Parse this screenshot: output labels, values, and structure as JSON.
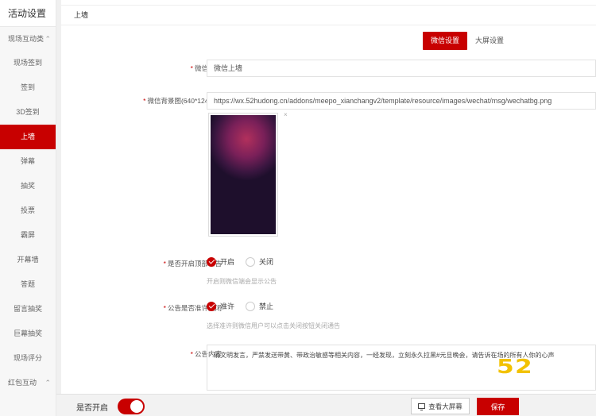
{
  "sidebar": {
    "title": "活动设置",
    "group1": {
      "label": "现场互动类",
      "chevron": "⌃"
    },
    "items": [
      {
        "label": "现场签到",
        "active": false
      },
      {
        "label": "签到",
        "active": false
      },
      {
        "label": "3D签到",
        "active": false
      },
      {
        "label": "上墙",
        "active": true
      },
      {
        "label": "弹幕",
        "active": false
      },
      {
        "label": "抽奖",
        "active": false
      },
      {
        "label": "投票",
        "active": false
      },
      {
        "label": "霸屏",
        "active": false
      },
      {
        "label": "开幕墙",
        "active": false
      },
      {
        "label": "答题",
        "active": false
      },
      {
        "label": "留言抽奖",
        "active": false
      },
      {
        "label": "巨幕抽奖",
        "active": false
      },
      {
        "label": "现场评分",
        "active": false
      }
    ],
    "group2": {
      "label": "红包互动",
      "chevron": "⌃"
    }
  },
  "main": {
    "header_title": "上墙",
    "tabs": [
      {
        "label": "微信设置",
        "active": true
      },
      {
        "label": "大屏设置",
        "active": false
      }
    ],
    "form": {
      "wechat_title_label": "微信标题",
      "wechat_title_value": "微信上墙",
      "wechat_bg_label": "微信背景图(640*1240px)",
      "wechat_bg_value": "https://wx.52hudong.cn/addons/meepo_xianchangv2/template/resource/images/wechat/msg/wechatbg.png",
      "img_close": "×",
      "notice_top_label": "是否开启顶部公告",
      "notice_top_opt_on": "开启",
      "notice_top_opt_off": "关闭",
      "notice_top_hint": "开启则微信端会显示公告",
      "notice_close_label": "公告是否准许关闭",
      "notice_close_opt_on": "准许",
      "notice_close_opt_off": "禁止",
      "notice_close_hint": "选择准许则微信用户可以点击关闭按钮关闭通告",
      "notice_content_label": "公告内容",
      "notice_content_value": "请文明发言，严禁发送带黄、带政治敏感等相关内容，一经发现，立刻永久拉黑#元旦晚会，请告诉在场的所有人你的心声"
    }
  },
  "watermark": "52",
  "bottom_bar": {
    "enable_label": "是否开启",
    "enabled": true,
    "view_screen_label": "查看大屏幕",
    "save_label": "保存"
  },
  "colors": {
    "accent": "#c80000"
  }
}
